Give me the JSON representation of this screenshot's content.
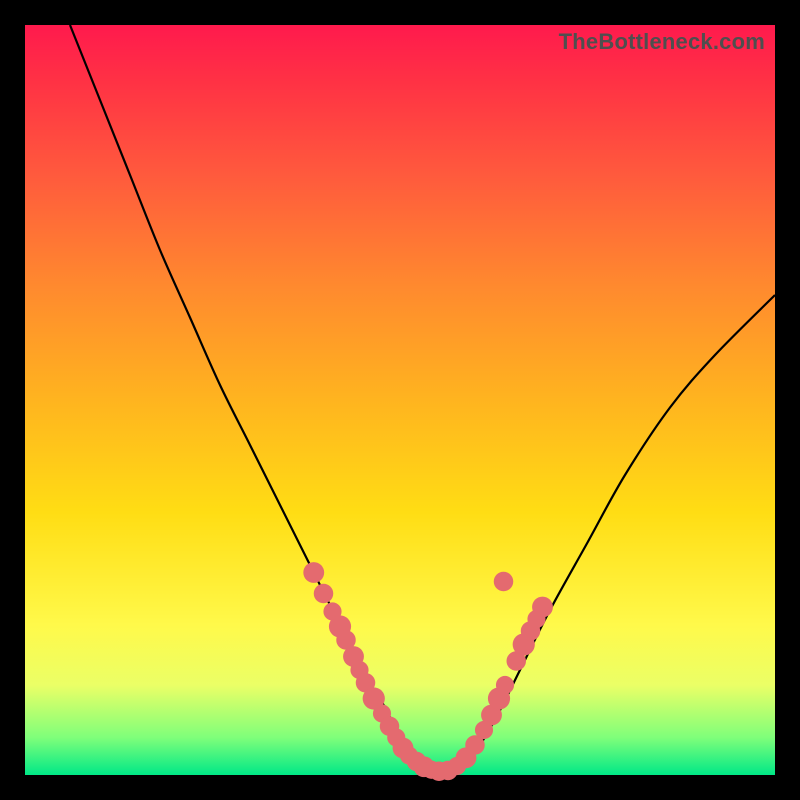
{
  "watermark": "TheBottleneck.com",
  "colors": {
    "bead": "#e46a6f",
    "curve": "#000000",
    "frame_bg_top": "#ff1a4d",
    "frame_bg_bottom": "#00e887",
    "page_bg": "#000000"
  },
  "chart_data": {
    "type": "line",
    "title": "",
    "xlabel": "",
    "ylabel": "",
    "xlim": [
      0,
      100
    ],
    "ylim": [
      0,
      100
    ],
    "grid": false,
    "legend": false,
    "series": [
      {
        "name": "curve",
        "x": [
          6,
          10,
          14,
          18,
          22,
          26,
          30,
          34,
          38,
          42,
          45,
          48,
          50,
          52,
          54,
          56,
          58,
          60,
          63,
          66,
          70,
          75,
          80,
          86,
          92,
          100
        ],
        "y": [
          100,
          90,
          80,
          70,
          61,
          52,
          44,
          36,
          28,
          20,
          14,
          9,
          5,
          2,
          0.8,
          0.5,
          1,
          3,
          8,
          14,
          22,
          31,
          40,
          49,
          56,
          64
        ]
      }
    ],
    "beads": {
      "name": "markers",
      "points": [
        {
          "x": 38.5,
          "y": 27,
          "r": 1.1
        },
        {
          "x": 39.8,
          "y": 24.2,
          "r": 1.0
        },
        {
          "x": 41.0,
          "y": 21.8,
          "r": 0.9
        },
        {
          "x": 42.0,
          "y": 19.8,
          "r": 1.2
        },
        {
          "x": 42.8,
          "y": 18.0,
          "r": 1.0
        },
        {
          "x": 43.8,
          "y": 15.8,
          "r": 1.1
        },
        {
          "x": 44.6,
          "y": 14.0,
          "r": 0.9
        },
        {
          "x": 45.4,
          "y": 12.3,
          "r": 1.0
        },
        {
          "x": 46.5,
          "y": 10.2,
          "r": 1.2
        },
        {
          "x": 47.6,
          "y": 8.2,
          "r": 0.9
        },
        {
          "x": 48.6,
          "y": 6.5,
          "r": 1.0
        },
        {
          "x": 49.5,
          "y": 5.0,
          "r": 0.9
        },
        {
          "x": 50.4,
          "y": 3.6,
          "r": 1.1
        },
        {
          "x": 51.2,
          "y": 2.6,
          "r": 0.9
        },
        {
          "x": 52.2,
          "y": 1.8,
          "r": 1.0
        },
        {
          "x": 53.2,
          "y": 1.1,
          "r": 1.1
        },
        {
          "x": 54.2,
          "y": 0.7,
          "r": 0.9
        },
        {
          "x": 55.2,
          "y": 0.5,
          "r": 1.0
        },
        {
          "x": 56.4,
          "y": 0.6,
          "r": 1.0
        },
        {
          "x": 57.6,
          "y": 1.2,
          "r": 0.9
        },
        {
          "x": 58.8,
          "y": 2.3,
          "r": 1.1
        },
        {
          "x": 60.0,
          "y": 4.0,
          "r": 1.0
        },
        {
          "x": 61.2,
          "y": 6.0,
          "r": 0.9
        },
        {
          "x": 62.2,
          "y": 8.0,
          "r": 1.1
        },
        {
          "x": 63.2,
          "y": 10.2,
          "r": 1.2
        },
        {
          "x": 64.0,
          "y": 12.0,
          "r": 0.9
        },
        {
          "x": 65.5,
          "y": 15.2,
          "r": 1.0
        },
        {
          "x": 66.5,
          "y": 17.4,
          "r": 1.2
        },
        {
          "x": 67.4,
          "y": 19.2,
          "r": 1.0
        },
        {
          "x": 68.2,
          "y": 20.8,
          "r": 0.9
        },
        {
          "x": 69.0,
          "y": 22.4,
          "r": 1.1
        },
        {
          "x": 63.8,
          "y": 25.8,
          "r": 1.0
        }
      ]
    }
  }
}
